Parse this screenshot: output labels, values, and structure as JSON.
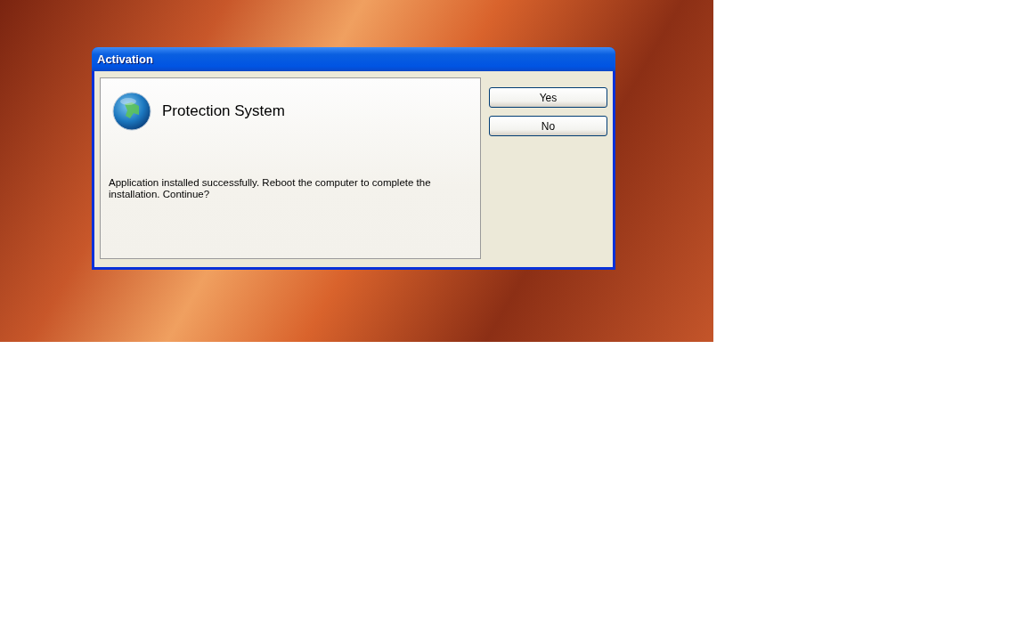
{
  "window": {
    "title": "Activation"
  },
  "panel": {
    "heading": "Protection System",
    "message": "Application installed successfully. Reboot the computer to complete the installation. Continue?"
  },
  "buttons": [
    {
      "label": "Yes"
    },
    {
      "label": "No"
    }
  ]
}
